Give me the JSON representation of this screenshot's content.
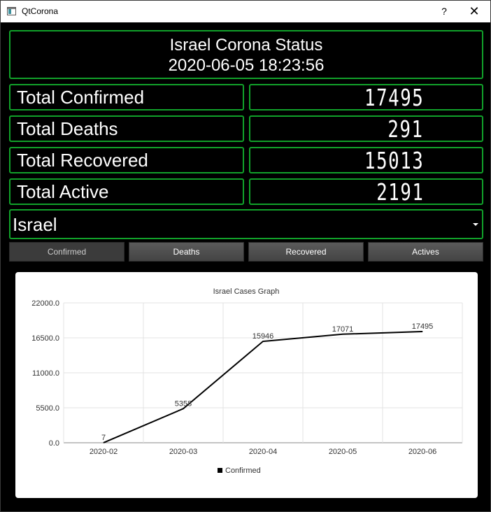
{
  "window": {
    "title": "QtCorona",
    "help_label": "?",
    "close_label": "✕"
  },
  "header": {
    "line1": "Israel Corona Status",
    "line2": "2020-06-05 18:23:56"
  },
  "stats": [
    {
      "label": "Total Confirmed",
      "value": "17495"
    },
    {
      "label": "Total Deaths",
      "value": "291"
    },
    {
      "label": "Total Recovered",
      "value": "15013"
    },
    {
      "label": "Total Active",
      "value": "2191"
    }
  ],
  "country_select": {
    "value": "Israel"
  },
  "buttons": [
    {
      "label": "Confirmed",
      "active": true
    },
    {
      "label": "Deaths",
      "active": false
    },
    {
      "label": "Recovered",
      "active": false
    },
    {
      "label": "Actives",
      "active": false
    }
  ],
  "colors": {
    "accent": "#11a12a",
    "background": "#000000",
    "series": "#000000"
  },
  "chart_data": {
    "type": "line",
    "title": "Israel Cases Graph",
    "categories": [
      "2020-02",
      "2020-03",
      "2020-04",
      "2020-05",
      "2020-06"
    ],
    "series": [
      {
        "name": "Confirmed",
        "values": [
          7,
          5358,
          15946,
          17071,
          17495
        ]
      }
    ],
    "data_labels": [
      "7",
      "5358",
      "15946",
      "17071",
      "17495"
    ],
    "y_ticks": [
      "0.0",
      "5500.0",
      "11000.0",
      "16500.0",
      "22000.0"
    ],
    "ylim": [
      0,
      22000
    ],
    "grid": true,
    "legend": "bottom"
  }
}
